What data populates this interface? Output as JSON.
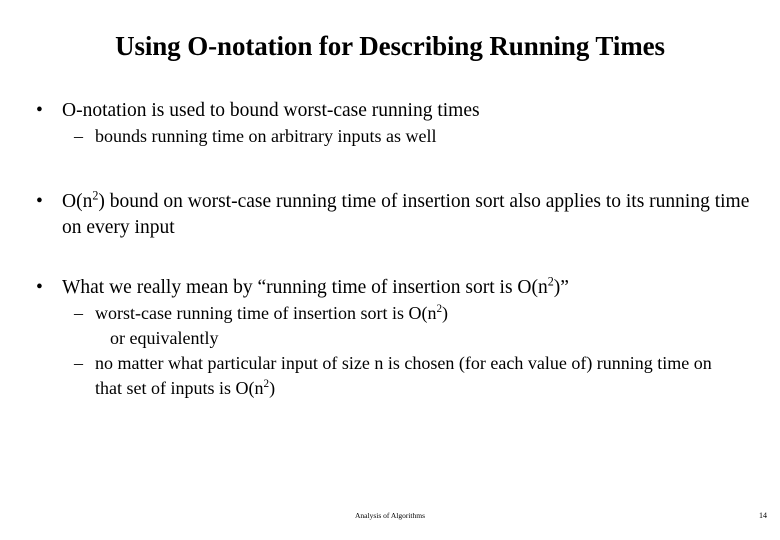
{
  "slide": {
    "title": "Using O-notation for Describing Running Times",
    "bullet_marker": "•",
    "dash_marker": "–",
    "blocks": [
      {
        "bullet": "O-notation is used to bound worst-case running times",
        "sub": "bounds running time on arbitrary inputs as well"
      },
      {
        "bullet_pre": "O(n",
        "bullet_sup": "2",
        "bullet_post": ") bound on worst-case running time of insertion sort also applies to its running time on every input"
      },
      {
        "bullet_pre": "What we really mean by “running time of insertion sort is O(n",
        "bullet_sup": "2",
        "bullet_post": ")”",
        "sub1_pre": "worst-case running time of insertion sort is O(n",
        "sub1_sup": "2",
        "sub1_post": ")",
        "sub2": "or equivalently",
        "sub3_pre": "no matter what particular input of size n is chosen (for each value of) running time on that set of inputs is O(n",
        "sub3_sup": "2",
        "sub3_post": ")"
      }
    ],
    "footer": "Analysis of Algorithms",
    "page_number": "14"
  }
}
